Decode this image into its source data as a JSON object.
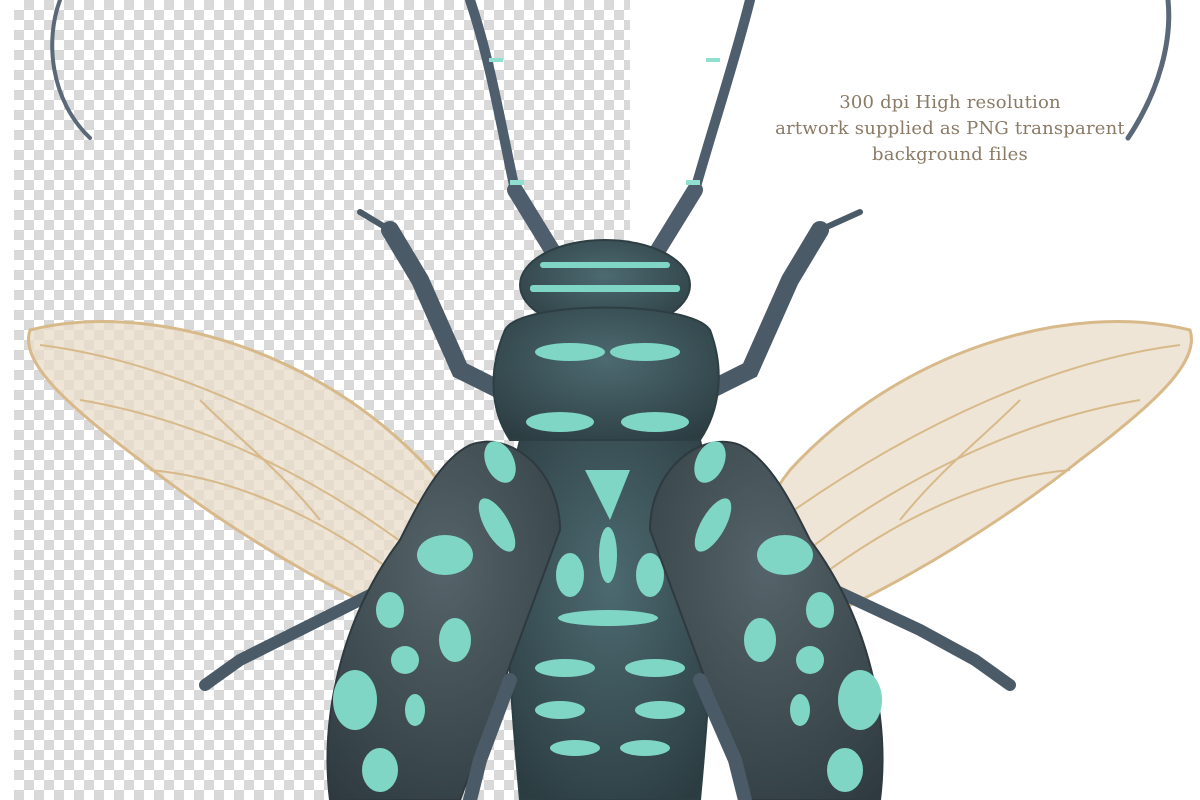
{
  "caption": {
    "line1": "300 dpi High resolution",
    "line2": "artwork supplied as PNG transparent",
    "line3": "background files"
  },
  "colors": {
    "body": "#3f555b",
    "body_dark": "#2e3f44",
    "spots": "#7fd6c4",
    "wing_fill": "#e8dcc8",
    "wing_vein": "#d8b98a",
    "antenna": "#5a6878",
    "caption_text": "#8a7a66",
    "checker": "#d9d9d9"
  }
}
